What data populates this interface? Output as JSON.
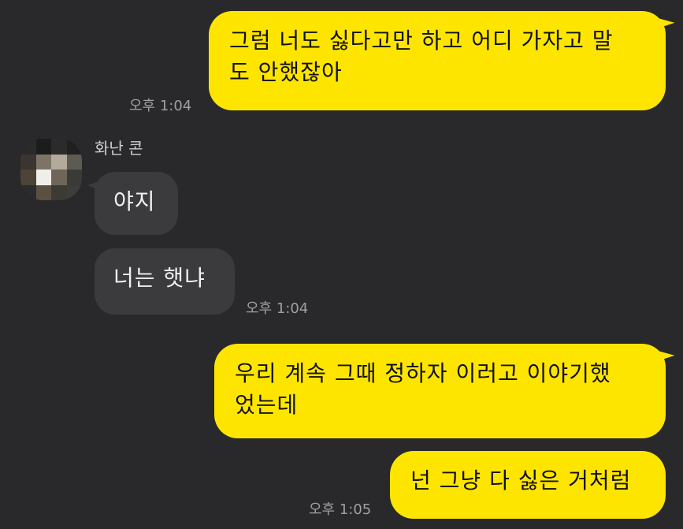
{
  "contact": {
    "name": "화난 콘"
  },
  "messages": [
    {
      "id": 1,
      "direction": "out",
      "lines": [
        "그럼 너도 싫다고만 하고 어디 가자고 말",
        "도 안했잖아"
      ],
      "time": "오후 1:04"
    },
    {
      "id": 2,
      "direction": "in",
      "lines": [
        "야지"
      ],
      "time": ""
    },
    {
      "id": 3,
      "direction": "in",
      "lines": [
        "너는 햇냐"
      ],
      "time": "오후 1:04"
    },
    {
      "id": 4,
      "direction": "out",
      "lines": [
        "우리 계속 그때 정하자 이러고 이야기했",
        "었는데"
      ],
      "time": ""
    },
    {
      "id": 5,
      "direction": "out",
      "lines": [
        "넌 그냥 다 싫은 거처럼"
      ],
      "time": "오후 1:05"
    }
  ],
  "colors": {
    "background": "#29292b",
    "outgoing_bubble": "#fee500",
    "incoming_bubble": "#3b3b3e",
    "incoming_text": "#f1f1f1",
    "timestamp": "#a0a0a3"
  }
}
